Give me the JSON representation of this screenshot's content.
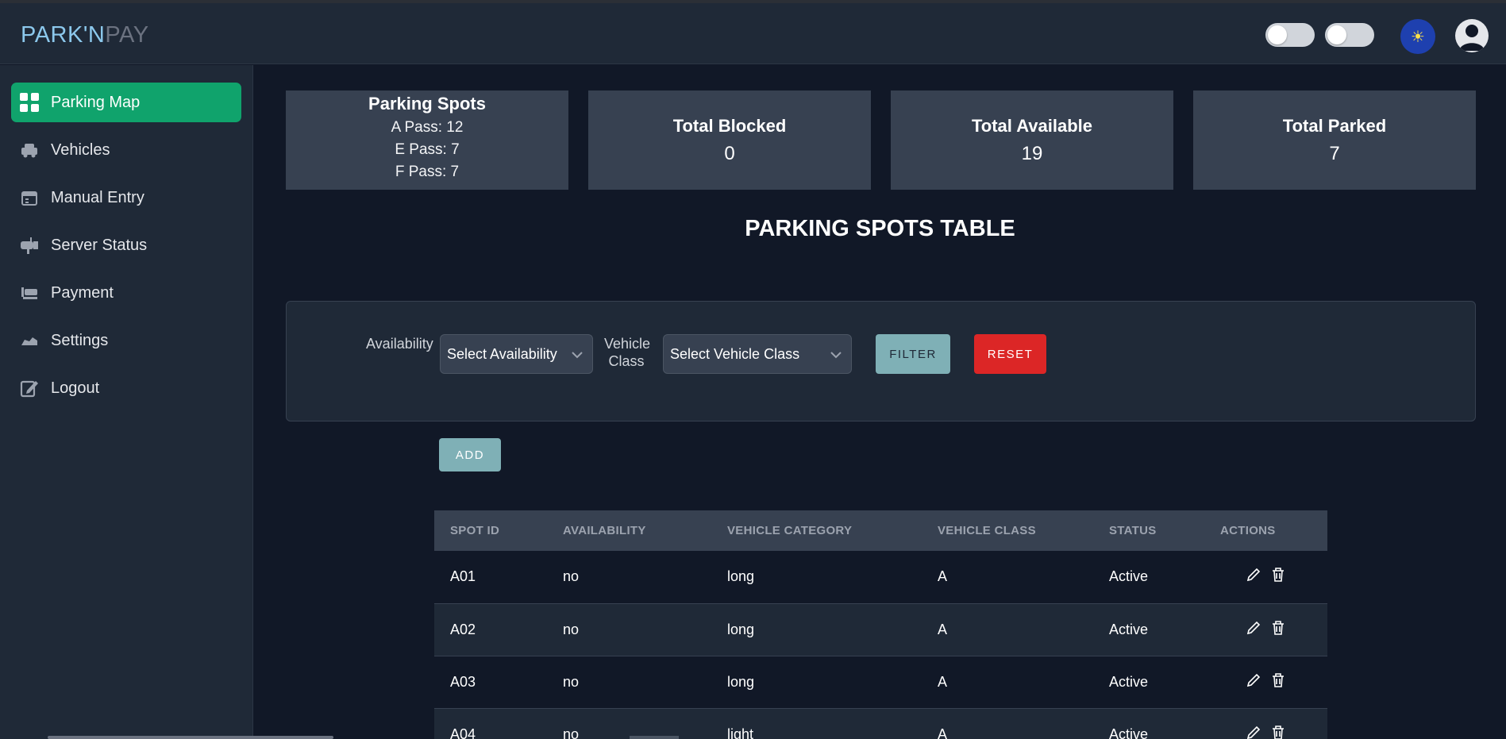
{
  "brand": {
    "part1": "PARK'N",
    "part2": "PAY"
  },
  "header": {
    "theme_icon": "sun-icon",
    "avatar_icon": "user-avatar-icon"
  },
  "sidebar": {
    "items": [
      {
        "label": "Parking Map",
        "icon": "grid-icon",
        "active": true
      },
      {
        "label": "Vehicles",
        "icon": "car-icon"
      },
      {
        "label": "Manual Entry",
        "icon": "calendar-icon"
      },
      {
        "label": "Server Status",
        "icon": "mailbox-icon"
      },
      {
        "label": "Payment",
        "icon": "payment-icon"
      },
      {
        "label": "Settings",
        "icon": "settings-icon"
      },
      {
        "label": "Logout",
        "icon": "logout-icon"
      }
    ]
  },
  "cards": {
    "spots": {
      "title": "Parking Spots",
      "passes": [
        "A Pass: 12",
        "E Pass: 7",
        "F Pass: 7"
      ]
    },
    "blocked": {
      "title": "Total Blocked",
      "value": "0"
    },
    "available": {
      "title": "Total Available",
      "value": "19"
    },
    "parked": {
      "title": "Total Parked",
      "value": "7"
    }
  },
  "page_title": "PARKING SPOTS TABLE",
  "filters": {
    "availability_label": "Availability",
    "availability_value": "Select Availability",
    "vehicle_class_label_1": "Vehicle",
    "vehicle_class_label_2": "Class",
    "vehicle_class_value": "Select Vehicle Class",
    "filter_label": "FILTER",
    "reset_label": "RESET"
  },
  "add_label": "ADD",
  "table": {
    "columns": [
      "SPOT ID",
      "AVAILABILITY",
      "VEHICLE CATEGORY",
      "VEHICLE CLASS",
      "STATUS",
      "ACTIONS"
    ],
    "rows": [
      [
        "A01",
        "no",
        "long",
        "A",
        "Active"
      ],
      [
        "A02",
        "no",
        "long",
        "A",
        "Active"
      ],
      [
        "A03",
        "no",
        "long",
        "A",
        "Active"
      ],
      [
        "A04",
        "no",
        "light",
        "A",
        "Active"
      ]
    ]
  }
}
